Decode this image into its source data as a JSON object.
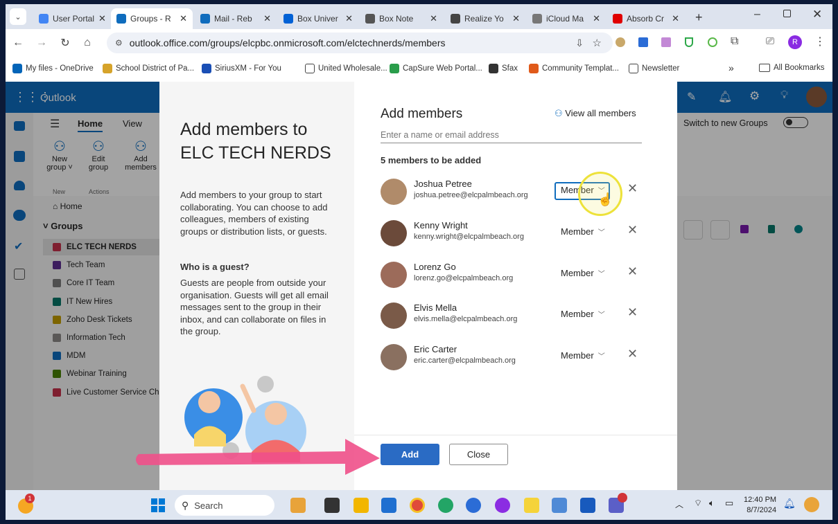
{
  "browser": {
    "tabs": [
      {
        "label": "User Portal",
        "color": "#4285f4"
      },
      {
        "label": "Groups - R",
        "color": "#0f6cbd",
        "active": true
      },
      {
        "label": "Mail - Reb",
        "color": "#0f6cbd"
      },
      {
        "label": "Box Univer",
        "color": "#0061d5"
      },
      {
        "label": "Box Note",
        "color": "#555555"
      },
      {
        "label": "Realize Yo",
        "color": "#444444"
      },
      {
        "label": "iCloud Ma",
        "color": "#777777"
      },
      {
        "label": "Absorb Cr",
        "color": "#e00000"
      }
    ],
    "url": "outlook.office.com/groups/elcpbc.onmicrosoft.com/elctechnerds/members",
    "profile_initial": "R",
    "bookmarks": [
      "My files - OneDrive",
      "School District of Pa...",
      "SiriusXM - For You",
      "United Wholesale...",
      "CapSure Web Portal...",
      "Sfax",
      "Community Templat...",
      "Newsletter"
    ],
    "overflow": "»",
    "all_bookmarks": "All Bookmarks"
  },
  "outlook": {
    "app_name": "Outlook",
    "ribbon_tabs": [
      "Home",
      "View"
    ],
    "ribbon_buttons": [
      {
        "label": "New group ˅"
      },
      {
        "label": "Edit group"
      },
      {
        "label": "Add members"
      }
    ],
    "ribbon_groups": [
      "New",
      "Actions"
    ],
    "switch_label": "Switch to new Groups",
    "nav_home": "Home",
    "nav_groups": "Groups",
    "groups": [
      {
        "label": "ELC TECH NERDS",
        "color": "#c4314b",
        "selected": true
      },
      {
        "label": "Tech Team",
        "color": "#5c2d91"
      },
      {
        "label": "Core IT Team",
        "color": "#7a7a7a"
      },
      {
        "label": "IT New Hires",
        "color": "#077568"
      },
      {
        "label": "Zoho Desk Tickets",
        "color": "#c19c00"
      },
      {
        "label": "Information Tech",
        "color": "#8a8886"
      },
      {
        "label": "MDM",
        "color": "#0f6cbd"
      },
      {
        "label": "Webinar Training",
        "color": "#498205"
      },
      {
        "label": "Live Customer Service Chat",
        "color": "#c4314b"
      }
    ]
  },
  "dialog": {
    "title": "Add members to ELC TECH NERDS",
    "description": "Add members to your group to start collaborating. You can choose to add colleagues, members of existing groups or distribution lists, or guests.",
    "guest_heading": "Who is a guest?",
    "guest_text": "Guests are people from outside your organisation. Guests will get all email messages sent to the group in their inbox, and can collaborate on files in the group.",
    "panel_title": "Add members",
    "view_all": "View all members",
    "search_placeholder": "Enter a name or email address",
    "count_label": "5 members to be added",
    "members": [
      {
        "name": "Joshua Petree",
        "email": "joshua.petree@elcpalmbeach.org",
        "role": "Member",
        "avatar_color": "#b08b6a"
      },
      {
        "name": "Kenny Wright",
        "email": "kenny.wright@elcpalmbeach.org",
        "role": "Member",
        "avatar_color": "#6b4a3a"
      },
      {
        "name": "Lorenz Go",
        "email": "lorenz.go@elcpalmbeach.org",
        "role": "Member",
        "avatar_color": "#9c6b5a"
      },
      {
        "name": "Elvis Mella",
        "email": "elvis.mella@elcpalmbeach.org",
        "role": "Member",
        "avatar_color": "#7a5a48"
      },
      {
        "name": "Eric Carter",
        "email": "eric.carter@elcpalmbeach.org",
        "role": "Member",
        "avatar_color": "#8a7060"
      }
    ],
    "add_label": "Add",
    "close_label": "Close"
  },
  "taskbar": {
    "search": "Search",
    "time": "12:40 PM",
    "date": "8/7/2024",
    "notification_badge": "1"
  }
}
